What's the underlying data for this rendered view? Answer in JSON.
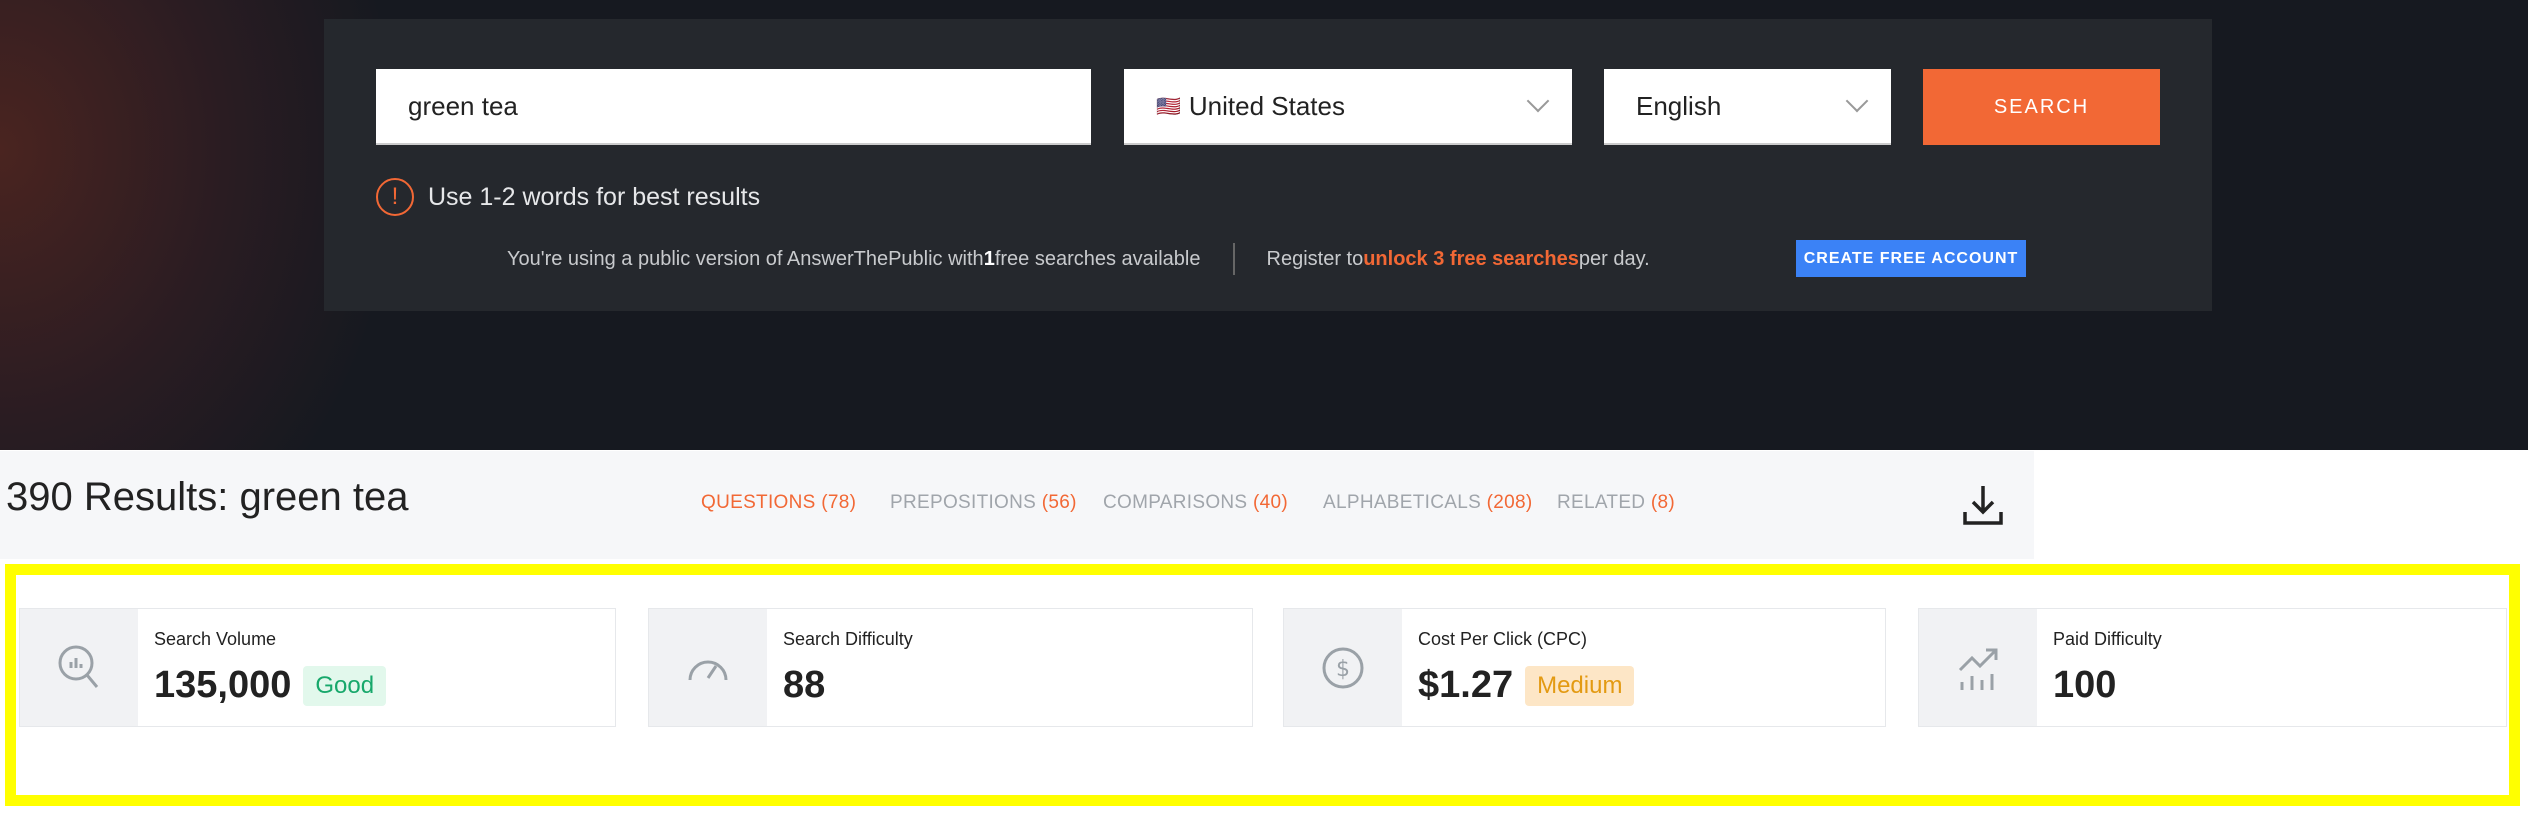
{
  "search": {
    "query": "green tea",
    "country": "United States",
    "country_flag": "🇺🇸",
    "language": "English",
    "button": "SEARCH"
  },
  "warning": "Use 1-2 words for best results",
  "notice": {
    "prefix": "You're using a public version of AnswerThePublic with ",
    "count": "1",
    "suffix": " free searches available",
    "register_prefix": "Register to ",
    "register_highlight": "unlock 3 free searches",
    "register_suffix": " per day.",
    "create_button": "CREATE FREE ACCOUNT"
  },
  "results": {
    "title": "390 Results: green tea",
    "tabs": [
      {
        "label": "QUESTIONS",
        "count": "(78)"
      },
      {
        "label": "PREPOSITIONS",
        "count": "(56)"
      },
      {
        "label": "COMPARISONS",
        "count": "(40)"
      },
      {
        "label": "ALPHABETICALS",
        "count": "(208)"
      },
      {
        "label": "RELATED",
        "count": "(8)"
      }
    ]
  },
  "metrics": [
    {
      "label": "Search Volume",
      "value": "135,000",
      "badge": "Good",
      "icon": "search-chart-icon"
    },
    {
      "label": "Search Difficulty",
      "value": "88",
      "icon": "gauge-icon"
    },
    {
      "label": "Cost Per Click (CPC)",
      "value": "$1.27",
      "badge": "Medium",
      "icon": "dollar-icon"
    },
    {
      "label": "Paid Difficulty",
      "value": "100",
      "icon": "trend-up-icon"
    }
  ],
  "colors": {
    "accent": "#f26835",
    "button_blue": "#3b82f6",
    "highlight": "#ffff00"
  }
}
